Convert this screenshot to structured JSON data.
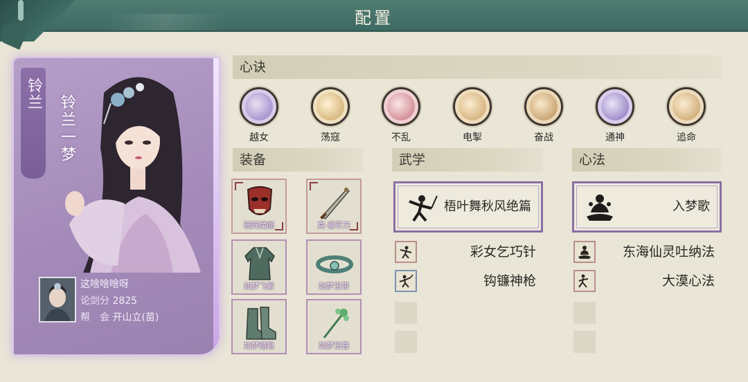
{
  "header": {
    "title": "配置"
  },
  "character": {
    "short_name": "铃兰",
    "full_name": "铃兰一梦",
    "player_name": "这啥啥啥呀",
    "score_label": "论剑分",
    "score_value": "2825",
    "guild_label": "帮　会",
    "guild_value": "开山立(苗)"
  },
  "sections": {
    "xinjue": "心诀",
    "equipment": "装备",
    "wuxue": "武学",
    "xinfa": "心法"
  },
  "xinjue_skills": [
    {
      "label": "越女",
      "icon": "crescent-moon-icon",
      "color": "#8f78c0"
    },
    {
      "label": "荡寇",
      "icon": "swirl-gold-icon",
      "color": "#c9a25e"
    },
    {
      "label": "不乱",
      "icon": "meditation-figure-icon",
      "color": "#c4707b"
    },
    {
      "label": "电掣",
      "icon": "lightning-l-icon",
      "color": "#c8a063"
    },
    {
      "label": "奋战",
      "icon": "flame-warrior-icon",
      "color": "#b98c55"
    },
    {
      "label": "通神",
      "icon": "spirit-temple-icon",
      "color": "#7f6bb8"
    },
    {
      "label": "追命",
      "icon": "dash-strike-icon",
      "color": "#c49a5c"
    }
  ],
  "equipment": [
    {
      "label": "破阵魔面",
      "icon": "demon-mask-icon"
    },
    {
      "label": "真·鎏芒刀",
      "icon": "blade-icon"
    },
    {
      "label": "如梦飞絮",
      "icon": "robe-icon"
    },
    {
      "label": "如梦玉带",
      "icon": "jade-belt-icon"
    },
    {
      "label": "如梦踏靴",
      "icon": "boots-icon"
    },
    {
      "label": "如梦玉簪",
      "icon": "jade-hairpin-icon"
    }
  ],
  "wuxue": {
    "main": "梧叶舞秋风绝篇",
    "items": [
      {
        "label": "彩女乞巧针",
        "icon": "needle-stance-icon"
      },
      {
        "label": "钩镰神枪",
        "icon": "spear-stance-icon"
      }
    ]
  },
  "xinfa": {
    "main": "入梦歌",
    "items": [
      {
        "label": "东海仙灵吐纳法",
        "icon": "lotus-sitting-icon"
      },
      {
        "label": "大漠心法",
        "icon": "desert-stance-icon"
      }
    ]
  }
}
